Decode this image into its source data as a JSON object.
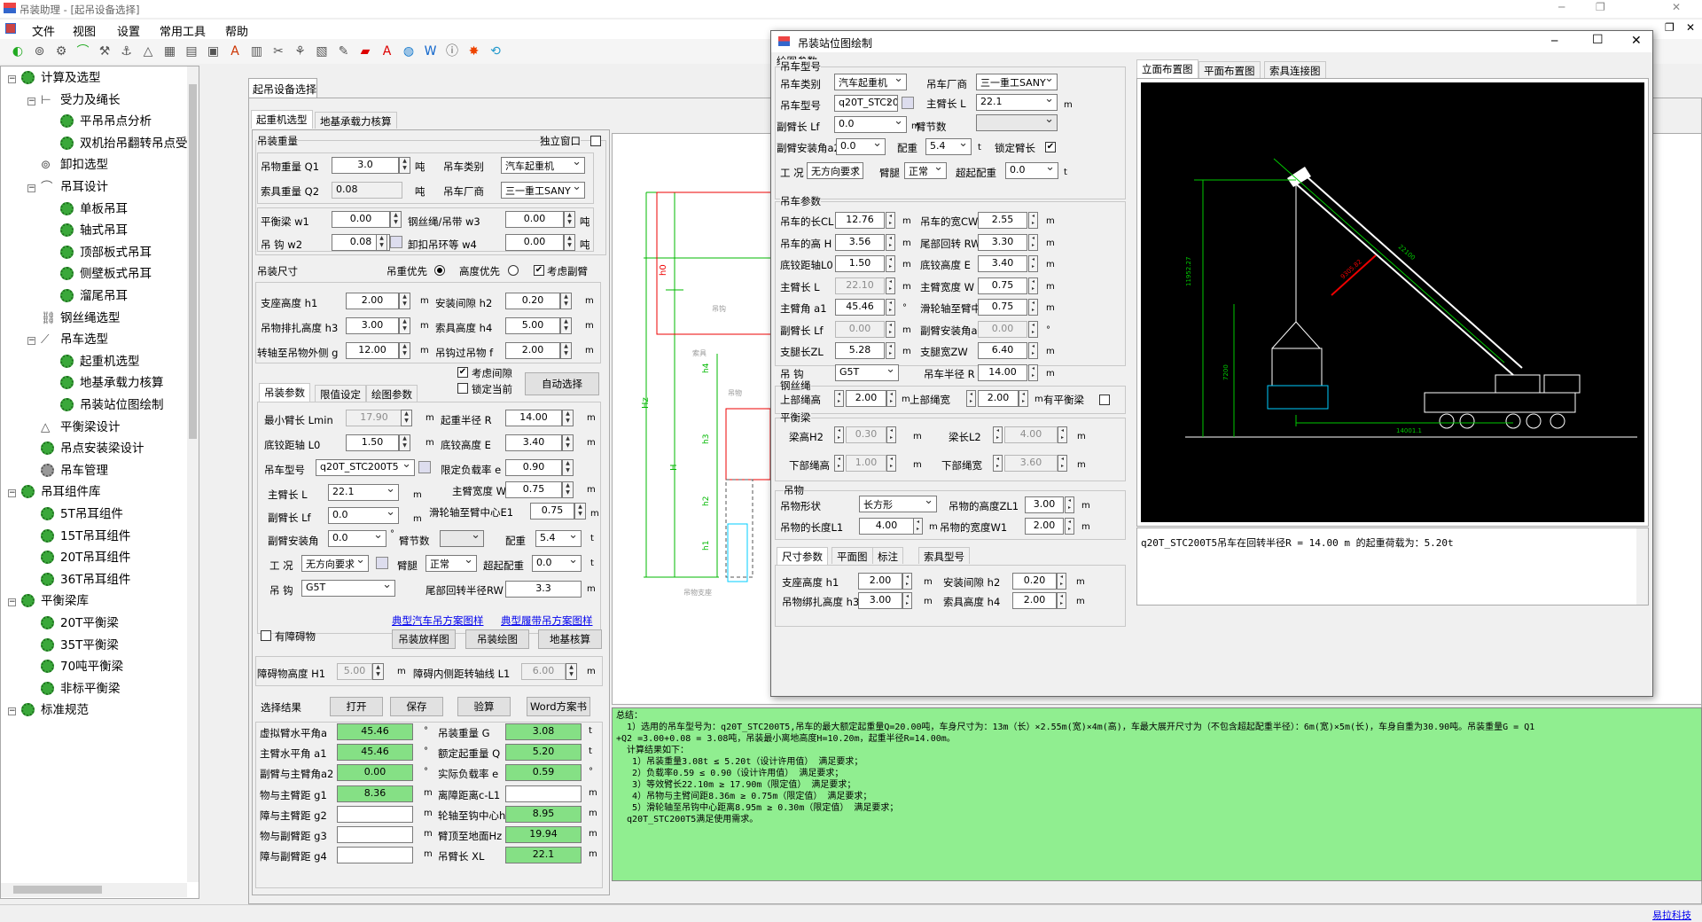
{
  "app": {
    "title": "吊装助理 - [起吊设备选择]",
    "minimize": "─",
    "restore": "❐",
    "close": "✕"
  },
  "menu": [
    "文件",
    "视图",
    "设置",
    "常用工具",
    "帮助"
  ],
  "toolbar_icons": [
    "green-circle-icon",
    "pipe-icon",
    "gear-tool-icon",
    "curve-icon",
    "crane-tool-icon",
    "hook-icon",
    "triangle-icon",
    "beam-icon",
    "grid-icon",
    "save-icon",
    "text-a-icon",
    "calculator-icon",
    "scissors-icon",
    "tools-icon",
    "paper-icon",
    "edit-icon",
    "pdf-icon",
    "font-a-icon",
    "globe-icon",
    "word-icon",
    "info-icon",
    "star-icon",
    "refresh-icon"
  ],
  "tree": [
    {
      "label": "计算及选型",
      "level": 0,
      "icon": "gear",
      "exp": "minus"
    },
    {
      "label": "受力及绳长",
      "level": 1,
      "icon": "ruler",
      "exp": "minus"
    },
    {
      "label": "平吊吊点分析",
      "level": 2,
      "icon": "gear"
    },
    {
      "label": "双机抬吊翻转吊点受力",
      "level": 2,
      "icon": "gear"
    },
    {
      "label": "卸扣选型",
      "level": 1,
      "icon": "shackle"
    },
    {
      "label": "吊耳设计",
      "level": 1,
      "icon": "arc",
      "exp": "minus"
    },
    {
      "label": "单板吊耳",
      "level": 2,
      "icon": "gear"
    },
    {
      "label": "轴式吊耳",
      "level": 2,
      "icon": "gear"
    },
    {
      "label": "顶部板式吊耳",
      "level": 2,
      "icon": "gear"
    },
    {
      "label": "侧壁板式吊耳",
      "level": 2,
      "icon": "gear"
    },
    {
      "label": "溜尾吊耳",
      "level": 2,
      "icon": "gear"
    },
    {
      "label": "钢丝绳选型",
      "level": 1,
      "icon": "rope"
    },
    {
      "label": "吊车选型",
      "level": 1,
      "icon": "crane",
      "exp": "minus"
    },
    {
      "label": "起重机选型",
      "level": 2,
      "icon": "gear"
    },
    {
      "label": "地基承载力核算",
      "level": 2,
      "icon": "gear"
    },
    {
      "label": "吊装站位图绘制",
      "level": 2,
      "icon": "gear"
    },
    {
      "label": "平衡梁设计",
      "level": 1,
      "icon": "triangle"
    },
    {
      "label": "吊点安装梁设计",
      "level": 1,
      "icon": "gear"
    },
    {
      "label": "吊车管理",
      "level": 1,
      "icon": "gear-grey"
    },
    {
      "label": "吊耳组件库",
      "level": 0,
      "icon": "gear",
      "exp": "minus"
    },
    {
      "label": "5T吊耳组件",
      "level": 1,
      "icon": "gear"
    },
    {
      "label": "15T吊耳组件",
      "level": 1,
      "icon": "gear"
    },
    {
      "label": "20T吊耳组件",
      "level": 1,
      "icon": "gear"
    },
    {
      "label": "36T吊耳组件",
      "level": 1,
      "icon": "gear"
    },
    {
      "label": "平衡梁库",
      "level": 0,
      "icon": "gear",
      "exp": "minus"
    },
    {
      "label": "20T平衡梁",
      "level": 1,
      "icon": "gear"
    },
    {
      "label": "35T平衡梁",
      "level": 1,
      "icon": "gear"
    },
    {
      "label": "70吨平衡梁",
      "level": 1,
      "icon": "gear"
    },
    {
      "label": "非标平衡梁",
      "level": 1,
      "icon": "gear"
    },
    {
      "label": "标准规范",
      "level": 0,
      "icon": "gear",
      "exp": "minus"
    }
  ],
  "doc_tab": "起吊设备选择",
  "sub_tabs": [
    "起重机选型",
    "地基承载力核算"
  ],
  "p1": {
    "load_title": "吊装重量",
    "independent": "独立窗口",
    "q1_l": "吊物重量 Q1",
    "q1": "3.0",
    "ton": "吨",
    "ctype_l": "吊车类别",
    "ctype": "汽车起重机",
    "q2_l": "索具重量 Q2",
    "q2": "0.08",
    "maker_l": "吊车厂商",
    "maker": "三一重工SANY",
    "w1_l": "平衡梁 w1",
    "w1": "0.00",
    "w3_l": "钢丝绳/吊带 w3",
    "w3": "0.00",
    "w2_l": "吊 钩 w2",
    "w2": "0.08",
    "w4_l": "卸扣吊环等 w4",
    "w4": "0.00",
    "size_title": "吊装尺寸",
    "rw": "吊重优先",
    "rh": "高度优先",
    "jib": "考虑副臂",
    "h1_l": "支座高度 h1",
    "h1": "2.00",
    "h2_l": "安装间隙 h2",
    "h2": "0.20",
    "h3_l": "吊物排扎高度 h3",
    "h3": "3.00",
    "h4_l": "索具高度 h4",
    "h4": "5.00",
    "g_l": "转轴至吊物外侧 g",
    "g": "12.00",
    "f_l": "吊钩过吊物 f",
    "f": "2.00",
    "m": "m",
    "gap": "考虑间隙",
    "lock": "锁定当前",
    "auto": "自动选择",
    "tabs": [
      "吊装参数",
      "限值设定",
      "绘图参数"
    ],
    "lmin_l": "最小臂长 Lmin",
    "lmin": "17.90",
    "r_l": "起重半径 R",
    "r": "14.00",
    "l0_l": "底铰距轴 L0",
    "l0": "1.50",
    "e_l": "底铰高度 E",
    "e": "3.40",
    "model_l": "吊车型号",
    "model": "q20T_STC200T5",
    "rate_l": "限定负载率 e",
    "rate": "0.90",
    "len_l": "主臂长 L",
    "len": "22.1",
    "width_l": "主臂宽度 W",
    "width": "0.75",
    "lf_l": "副臂长 Lf",
    "lf": "0.0",
    "e1_l": "滑轮轴至臂中心E1",
    "e1": "0.75",
    "a2_l": "副臂安装角",
    "a2": "0.0",
    "secs_l": "臂节数",
    "cfg_l": "配重",
    "cfg": "5.4",
    "t": "t",
    "wk_l": "工 况",
    "wk": "无方向要求",
    "leg_l": "臂腿",
    "leg": "正常",
    "cw_l": "超起配重",
    "cw": "0.0",
    "hook_l": "吊 钩",
    "hook": "G5T",
    "rw_l": "尾部回转半径RW",
    "rwv": "3.3",
    "link1": "典型汽车吊方案图样",
    "link2": "典型履带吊方案图样",
    "obs": "有障碍物",
    "b_pic": "吊装放样图",
    "b_draw": "吊装绘图",
    "b_ground": "地基核算",
    "h1o_l": "障碍物高度 H1",
    "h1o": "5.00",
    "l1o_l": "障碍内侧距转轴线 L1",
    "l1o": "6.00",
    "res_l": "选择结果",
    "open": "打开",
    "save": "保存",
    "check": "验算",
    "word": "Word方案书",
    "r1a_l": "虚拟臂水平角a",
    "r1a": "45.46",
    "r1b_l": "吊装重量 G",
    "r1b": "3.08",
    "r2a_l": "主臂水平角 a1",
    "r2a": "45.46",
    "r2b_l": "额定起重量 Q",
    "r2b": "5.20",
    "r3a_l": "副臂与主臂角a2",
    "r3a": "0.00",
    "r3b_l": "实际负载率 e",
    "r3b": "0.59",
    "r4a_l": "物与主臂距 g1",
    "r4a": "8.36",
    "r4b_l": "离障距离c-L1",
    "r4b": "",
    "r5a_l": "障与主臂距 g2",
    "r5a": "",
    "r5b_l": "轮轴至钩中心h0",
    "r5b": "8.95",
    "r6a_l": "物与副臂距 g3",
    "r6a": "",
    "r6b_l": "臂顶至地面Hz",
    "r6b": "19.94",
    "r7a_l": "障与副臂距 g4",
    "r7a": "",
    "r7b_l": "吊臂长 XL",
    "r7b": "22.1",
    "deg": "°",
    "tt": "t",
    "mm": "m"
  },
  "sketch": {
    "h0": "h0",
    "hz": "Hz",
    "h": "H",
    "h4": "h4",
    "h3": "h3",
    "h2": "h2",
    "h1": "h1",
    "labels": [
      "吊钩",
      "索具",
      "吊物",
      "吊物支座"
    ]
  },
  "summary": "总结：\n  1）选用的吊车型号为：q20T_STC200T5,吊车的最大额定起重量Q=20.00吨，车身尺寸为：13m（长）×2.55m(宽)×4m(高)，车最大展开尺寸为（不包含超起配重半径）：6m(宽)×5m(长)，车身自重为30.90吨。吊装重量G = Q1\n+Q2 =3.00+0.08 = 3.08吨，吊装最小离地高度H=10.20m，起重半径R=14.00m。\n  计算结果如下：\n   1）吊装重量3.08t ≤ 5.20t（设计许用值） 满足要求；\n   2）负载率0.59 ≤ 0.90（设计许用值） 满足要求；\n   3）等效臂长22.10m ≥ 17.90m（限定值） 满足要求；\n   4）吊物与主臂间距8.36m ≥ 0.75m（限定值） 满足要求；\n   5）滑轮轴至吊钩中心距离8.95m ≥ 0.30m（限定值） 满足要求；\n  q20T_STC200T5满足使用需求。",
  "dialog": {
    "title": "吊装站位图绘制",
    "min": "─",
    "max": "☐",
    "close": "✕",
    "draw_params": "绘图参数",
    "model_group": "吊车型号",
    "ctype_l": "吊车类别",
    "ctype": "汽车起重机",
    "maker_l": "吊车厂商",
    "maker": "三一重工SANY",
    "model_l": "吊车型号",
    "model": "q20T_STC2007",
    "len_l": "主臂长 L",
    "len": "22.1",
    "lf_l": "副臂长 Lf",
    "lf": "0.0",
    "secs_l": "臂节数",
    "a2_l": "副臂安装角a2",
    "a2": "0.0",
    "cfg_l": "配重",
    "cfg": "5.4",
    "lock_l": "锁定臂长",
    "wk_l": "工 况",
    "wk": "无方向要求",
    "leg_l": "臂腿",
    "leg": "正常",
    "cw_l": "超起配重",
    "cw": "0.0",
    "crane_group": "吊车参数",
    "cl_l": "吊车的长CL",
    "cl": "12.76",
    "cw2_l": "吊车的宽CW",
    "cw2": "2.55",
    "hh_l": "吊车的高 H",
    "hh": "3.56",
    "rwl": "尾部回转 RW",
    "rw": "3.30",
    "l0_l": "底铰距轴L0",
    "l0": "1.50",
    "e_l": "底铰高度 E",
    "e": "3.40",
    "ml_l": "主臂长 L",
    "ml": "22.10",
    "mw_l": "主臂宽度 W",
    "mw": "0.75",
    "a1_l": "主臂角 a1",
    "a1": "45.46",
    "e1_l": "滑轮轴至臂中心E1",
    "e1": "0.75",
    "jl_l": "副臂长 Lf",
    "jl": "0.00",
    "ja_l": "副臂安装角a2",
    "ja": "0.00",
    "zl_l": "支腿长ZL",
    "zl": "5.28",
    "zw_l": "支腿宽ZW",
    "zw": "6.40",
    "hook_l": "吊 钩",
    "hook": "G5T",
    "r_l": "吊车半径 R",
    "r": "14.00",
    "rope_group": "钢丝绳",
    "up_l": "上部绳高",
    "up": "2.00",
    "uw_l": "上部绳宽",
    "uw": "2.00",
    "beam_cb": "有平衡梁",
    "beam_group": "平衡梁",
    "bh_l": "梁高H2",
    "bh": "0.30",
    "bl_l": "梁长L2",
    "bl": "4.00",
    "dh_l": "下部绳高",
    "dh": "1.00",
    "dw_l": "下部绳宽",
    "dw": "3.60",
    "obj_group": "吊物",
    "shape_l": "吊物形状",
    "shape": "长方形",
    "zl1_l": "吊物的高度ZL1",
    "zl1": "3.00",
    "l1_l": "吊物的长度L1",
    "l1": "4.00",
    "w1_l": "吊物的宽度W1",
    "w1": "2.00",
    "btabs": [
      "尺寸参数",
      "平面图",
      "标注",
      "索具型号"
    ],
    "bh1_l": "支座高度 h1",
    "bh1": "2.00",
    "bh2_l": "安装间隙 h2",
    "bh2": "0.20",
    "bh3_l": "吊物绑扎高度 h3",
    "bh3": "3.00",
    "bh4_l": "索具高度 h4",
    "bh4": "2.00",
    "dtabs": [
      "立面布置图",
      "平面布置图",
      "索具连接图"
    ],
    "dims": {
      "d1": "11952.27",
      "d2": "7200",
      "d3": "14001.1",
      "d4": "22100",
      "d5": "9305.82"
    },
    "status": "q20T_STC200T5吊车在回转半径R = 14.00 m 的起重荷载为：5.20t",
    "m": "m",
    "t": "t",
    "deg": "°"
  },
  "footer": "易拉科技"
}
